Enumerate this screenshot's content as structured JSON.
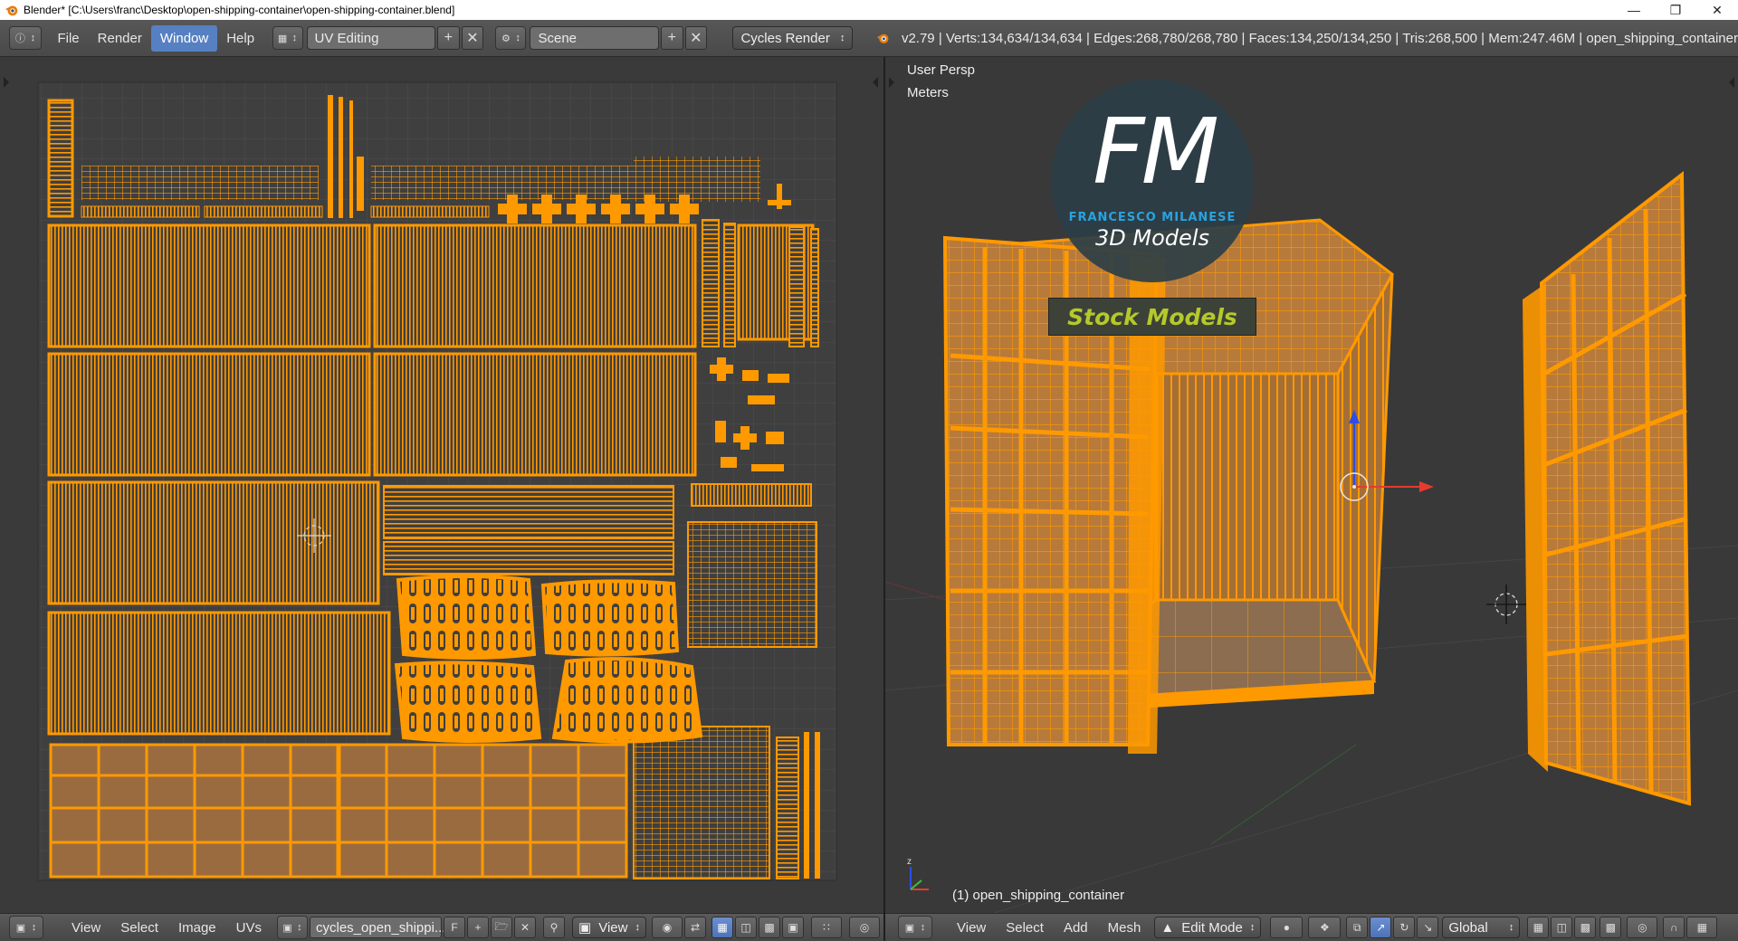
{
  "window": {
    "title": "Blender* [C:\\Users\\franc\\Desktop\\open-shipping-container\\open-shipping-container.blend]"
  },
  "topbar": {
    "menus": [
      "File",
      "Render",
      "Window",
      "Help"
    ],
    "active_menu": "Window",
    "layout": "UV Editing",
    "scene": "Scene",
    "engine": "Cycles Render",
    "stats": "v2.79 | Verts:134,634/134,634 | Edges:268,780/268,780 | Faces:134,250/134,250 | Tris:268,500 | Mem:247.46M | open_shipping_container"
  },
  "viewport": {
    "view_label": "User Persp",
    "units_label": "Meters",
    "object_label": "(1) open_shipping_container"
  },
  "watermark": {
    "monogram": "FM",
    "name": "FRANCESCO MILANESE",
    "subtitle": "3D Models",
    "banner": "Stock Models"
  },
  "uv_bottom": {
    "menus": [
      "View",
      "Select",
      "Image",
      "UVs"
    ],
    "image_name": "cycles_open_shippi...",
    "fake_user": "F",
    "view_select": "View"
  },
  "vp_bottom": {
    "menus": [
      "View",
      "Select",
      "Add",
      "Mesh"
    ],
    "mode": "Edit Mode",
    "orientation": "Global"
  },
  "colors": {
    "wire": "#ff9900",
    "face_fill": "#9a6b3f",
    "uv_bg": "#3a3a3a",
    "grid": "#444444",
    "header": "#4f4f4f",
    "active_menu": "#5680c2",
    "watermark_blue": "#29a3e0",
    "banner_text": "#b5c92a"
  }
}
